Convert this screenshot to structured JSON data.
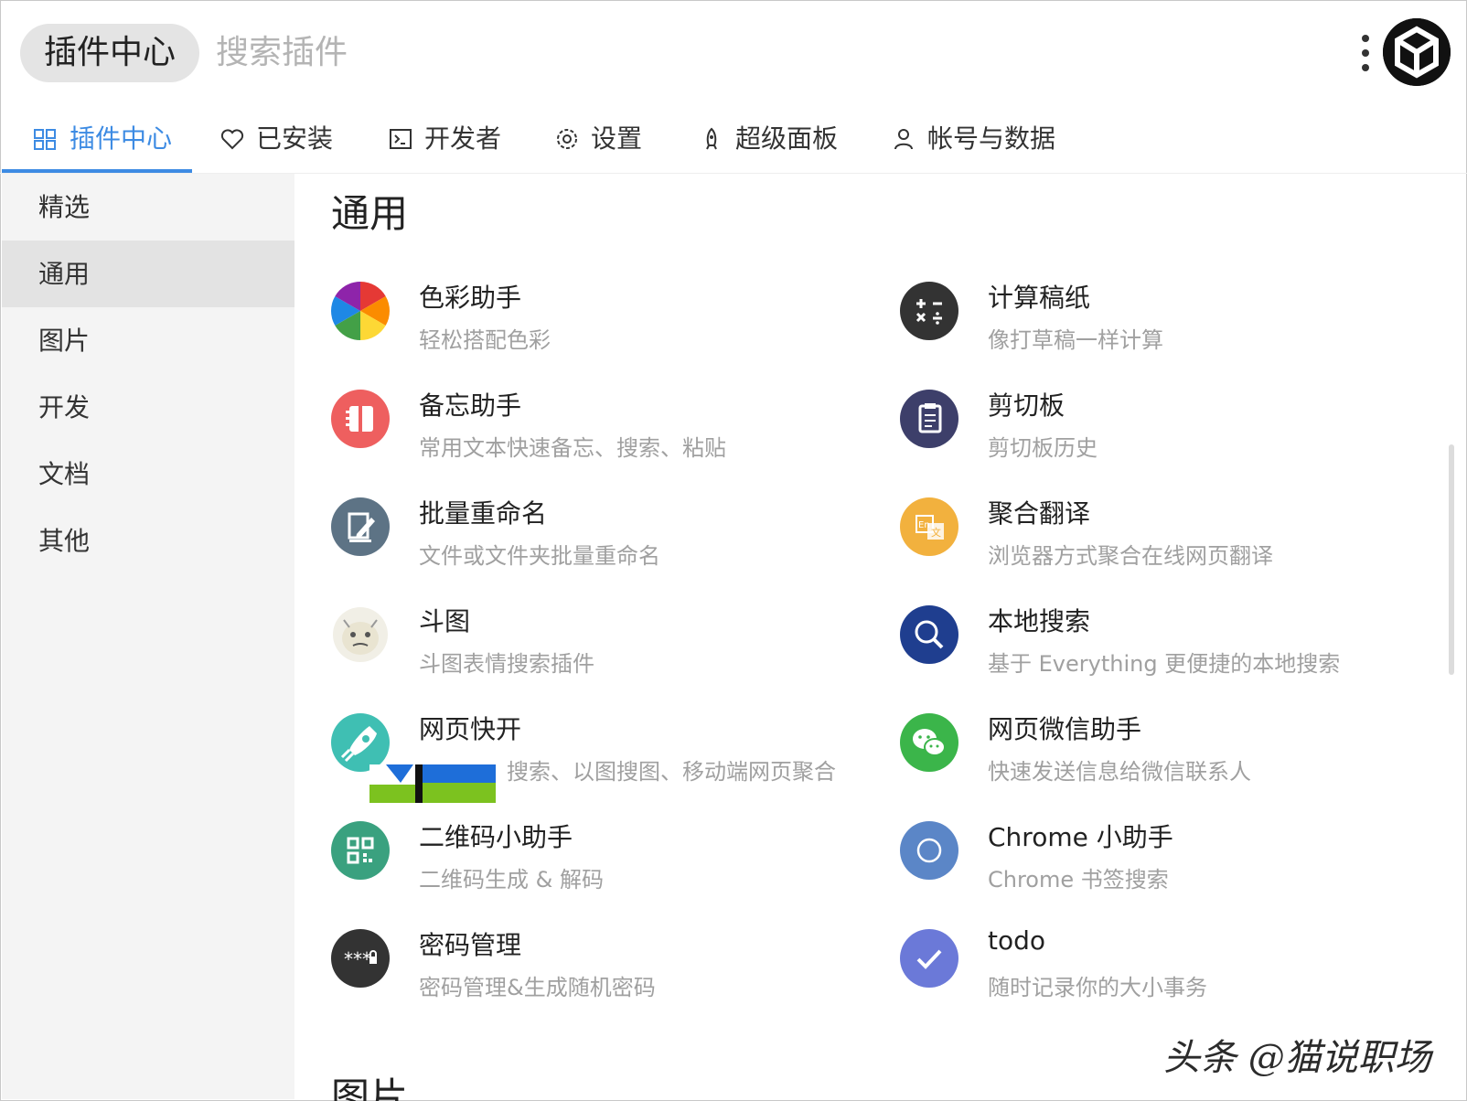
{
  "header": {
    "pill_label": "插件中心",
    "search_placeholder": "搜索插件"
  },
  "tabs": [
    {
      "label": "插件中心",
      "icon": "grid-icon",
      "active": true
    },
    {
      "label": "已安装",
      "icon": "heart-icon"
    },
    {
      "label": "开发者",
      "icon": "terminal-icon"
    },
    {
      "label": "设置",
      "icon": "gear-icon"
    },
    {
      "label": "超级面板",
      "icon": "rocket-icon"
    },
    {
      "label": "帐号与数据",
      "icon": "user-icon"
    }
  ],
  "sidebar": {
    "items": [
      {
        "label": "精选"
      },
      {
        "label": "通用",
        "active": true
      },
      {
        "label": "图片"
      },
      {
        "label": "开发"
      },
      {
        "label": "文档"
      },
      {
        "label": "其他"
      }
    ]
  },
  "main": {
    "section_title": "通用",
    "next_section_title": "图片",
    "plugins_left": [
      {
        "name": "色彩助手",
        "desc": "轻松搭配色彩",
        "icon": "color-wheel-icon"
      },
      {
        "name": "备忘助手",
        "desc": "常用文本快速备忘、搜索、粘贴",
        "icon": "notebook-icon",
        "color": "#ee5f5f"
      },
      {
        "name": "批量重命名",
        "desc": "文件或文件夹批量重命名",
        "icon": "edit-icon",
        "color": "#5d7385"
      },
      {
        "name": "斗图",
        "desc": "斗图表情搜索插件",
        "icon": "meme-face-icon"
      },
      {
        "name": "网页快开",
        "desc": "搜索、以图搜图、移动端网页聚合",
        "icon": "rocket-launch-icon",
        "color": "#3fbfb3"
      },
      {
        "name": "二维码小助手",
        "desc": "二维码生成 & 解码",
        "icon": "qrcode-icon",
        "color": "#3aa17f"
      },
      {
        "name": "密码管理",
        "desc": "密码管理&生成随机密码",
        "icon": "password-icon",
        "color": "#333333"
      }
    ],
    "plugins_right": [
      {
        "name": "计算稿纸",
        "desc": "像打草稿一样计算",
        "icon": "calculator-icon",
        "color": "#333333"
      },
      {
        "name": "剪切板",
        "desc": "剪切板历史",
        "icon": "clipboard-icon",
        "color": "#3d3f6a"
      },
      {
        "name": "聚合翻译",
        "desc": "浏览器方式聚合在线网页翻译",
        "icon": "translate-icon",
        "color": "#f2b13e"
      },
      {
        "name": "本地搜索",
        "desc": "基于 Everything 更便捷的本地搜索",
        "icon": "search-icon",
        "color": "#1f3e8f"
      },
      {
        "name": "网页微信助手",
        "desc": "快速发送信息给微信联系人",
        "icon": "wechat-icon",
        "color": "#3bb54a"
      },
      {
        "name": "Chrome 小助手",
        "desc": "Chrome 书签搜索",
        "icon": "chrome-icon",
        "color": "#5b86c7"
      },
      {
        "name": "todo",
        "desc": "随时记录你的大小事务",
        "icon": "check-icon",
        "color": "#6b79d8"
      }
    ]
  },
  "watermark": "头条 @猫说职场"
}
